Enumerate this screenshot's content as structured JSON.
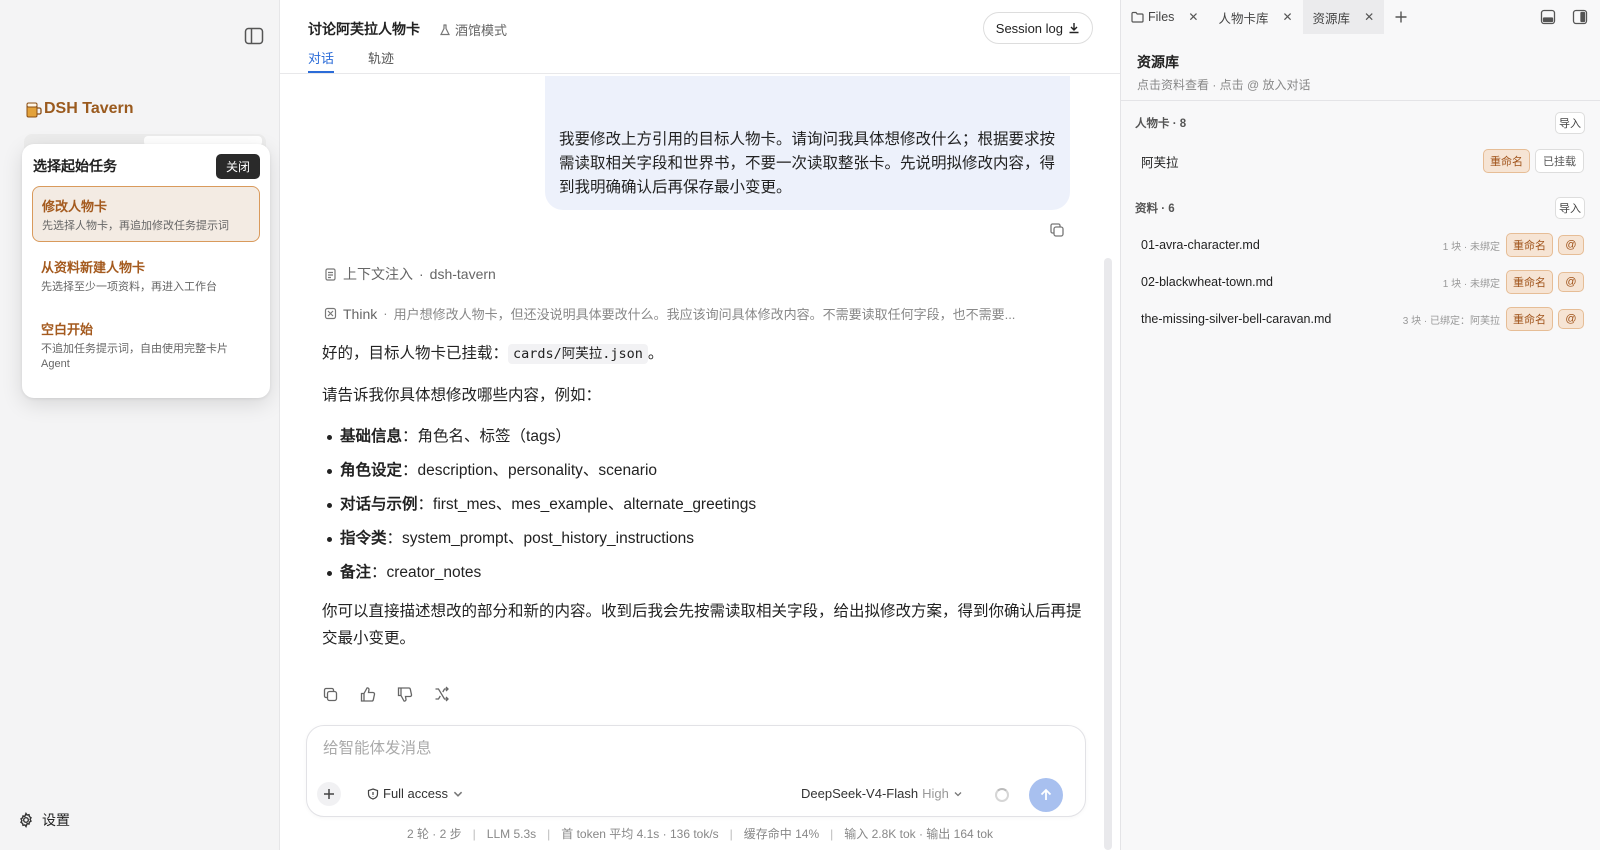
{
  "sidebar": {
    "brand": "DSH Tavern",
    "popup": {
      "title": "选择起始任务",
      "close_label": "关闭",
      "tasks": [
        {
          "title": "修改人物卡",
          "desc": "先选择人物卡，再追加修改任务提示词"
        },
        {
          "title": "从资料新建人物卡",
          "desc": "先选择至少一项资料，再进入工作台"
        },
        {
          "title": "空白开始",
          "desc": "不追加任务提示词，自由使用完整卡片 Agent"
        }
      ]
    },
    "settings_label": "设置"
  },
  "header": {
    "title": "讨论阿芙拉人物卡",
    "mode_label": "酒馆模式",
    "session_log_label": "Session log",
    "tabs": [
      "对话",
      "轨迹"
    ]
  },
  "conversation": {
    "user_message": "我要修改上方引用的目标人物卡。请询问我具体想修改什么；根据要求按需读取相关字段和世界书，不要一次读取整张卡。先说明拟修改内容，得到我明确确认后再保存最小变更。",
    "context_injection": {
      "label": "上下文注入",
      "source": "dsh-tavern"
    },
    "think": {
      "label": "Think",
      "text": "用户想修改人物卡，但还没说明具体要改什么。我应该询问具体修改内容。不需要读取任何字段，也不需要..."
    },
    "reply": {
      "intro_prefix": "好的，目标人物卡已挂载：",
      "intro_code": "cards/阿芙拉.json",
      "intro_suffix": "。",
      "ask": "请告诉我你具体想修改哪些内容，例如：",
      "items": [
        {
          "label": "基础信息",
          "text": "：角色名、标签（tags）"
        },
        {
          "label": "角色设定",
          "text": "：description、personality、scenario"
        },
        {
          "label": "对话与示例",
          "text": "：first_mes、mes_example、alternate_greetings"
        },
        {
          "label": "指令类",
          "text": "：system_prompt、post_history_instructions"
        },
        {
          "label": "备注",
          "text": "：creator_notes"
        }
      ],
      "closing": "你可以直接描述想改的部分和新的内容。收到后我会先按需读取相关字段，给出拟修改方案，得到你确认后再提交最小变更。"
    }
  },
  "composer": {
    "placeholder": "给智能体发消息",
    "access_label": "Full access",
    "model_name": "DeepSeek-V4-Flash",
    "model_level": "High"
  },
  "stats": [
    "2 轮 · 2 步",
    "LLM 5.3s",
    "首 token 平均 4.1s · 136 tok/s",
    "缓存命中 14%",
    "输入 2.8K tok · 输出 164 tok"
  ],
  "panel": {
    "tabs": [
      {
        "label": "Files",
        "active": false
      },
      {
        "label": "人物卡库",
        "active": false
      },
      {
        "label": "资源库",
        "active": true
      }
    ],
    "title": "资源库",
    "subtitle": "点击资料查看 · 点击 @ 放入对话",
    "characters": {
      "title": "人物卡 · 8",
      "import_label": "导入",
      "items": [
        {
          "name": "阿芙拉",
          "rename_label": "重命名",
          "status": "已挂载"
        }
      ]
    },
    "materials": {
      "title": "资料 · 6",
      "import_label": "导入",
      "items": [
        {
          "name": "01-avra-character.md",
          "meta": "1 块 · 未绑定",
          "rename_label": "重命名",
          "at_label": "@"
        },
        {
          "name": "02-blackwheat-town.md",
          "meta": "1 块 · 未绑定",
          "rename_label": "重命名",
          "at_label": "@"
        },
        {
          "name": "the-missing-silver-bell-caravan.md",
          "meta": "3 块 · 已绑定：阿芙拉",
          "rename_label": "重命名",
          "at_label": "@"
        }
      ]
    }
  }
}
